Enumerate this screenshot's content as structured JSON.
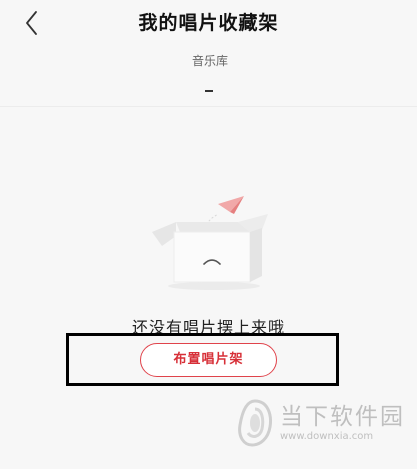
{
  "header": {
    "title": "我的唱片收藏架",
    "back_icon": "chevron-left-icon"
  },
  "tabs": [
    {
      "label": "音乐库",
      "active": true
    }
  ],
  "empty_state": {
    "illustration": "open-box-with-paper-plane",
    "message": "还没有唱片摆上来哦",
    "button_label": "布置唱片架"
  },
  "watermark": {
    "name": "当下软件园",
    "url": "www.downxia.com"
  },
  "colors": {
    "background": "#f7f7f7",
    "accent": "#d73038",
    "highlight_border": "#000000",
    "watermark": "#bfbfbf"
  }
}
